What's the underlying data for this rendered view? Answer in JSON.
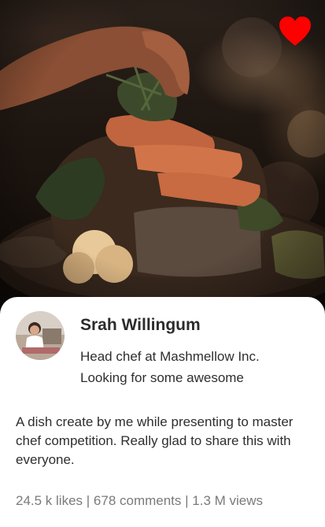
{
  "photo": {
    "icon": "food-photo"
  },
  "like_button": {
    "icon": "heart-icon",
    "color": "#ff0000"
  },
  "profile": {
    "avatar_icon": "avatar",
    "name": "Srah Willingum",
    "bio_line1": "Head chef at Mashmellow Inc.",
    "bio_line2": "Looking for some awesome"
  },
  "post": {
    "description": "A dish create by me while presenting to master chef competition. Really glad to share this with everyone."
  },
  "stats": {
    "text": "24.5 k likes | 678 comments | 1.3 M views"
  }
}
